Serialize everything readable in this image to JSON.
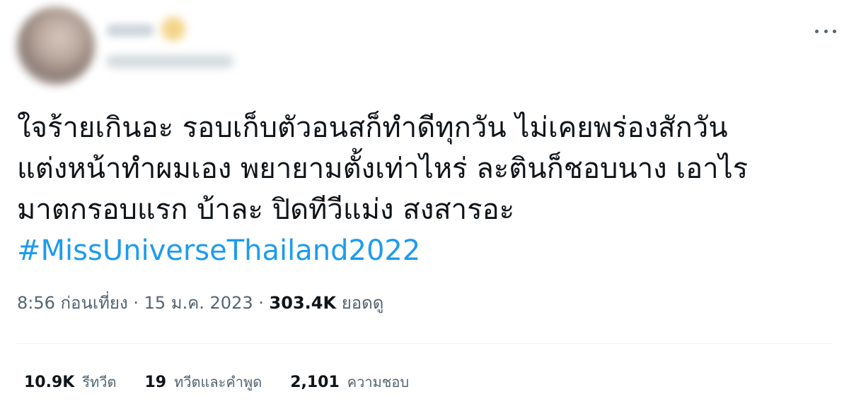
{
  "tweet": {
    "more_icon": "more-horizontal-icon",
    "text_lines": [
      "ใจร้ายเกินอะ รอบเก็บตัวอนสก็ทำดีทุกวัน ไม่เคยพร่องสักวัน",
      "แต่งหน้าทำผมเอง พยายามตั้งเท่าไหร่ ละตินก็ชอบนาง เอาไร",
      "มาตกรอบแรก บ้าละ ปิดทีวีแม่ง สงสารอะ"
    ],
    "hashtag": "#MissUniverseThailand2022",
    "time": "8:56 ก่อนเที่ยง",
    "separator": "·",
    "date": "15 ม.ค. 2023",
    "views_count": "303.4K",
    "views_label": "ยอดดู"
  },
  "stats": {
    "retweets_count": "10.9K",
    "retweets_label": "รีทวีต",
    "quotes_count": "19",
    "quotes_label": "ทวีตและคำพูด",
    "likes_count": "2,101",
    "likes_label": "ความชอบ"
  },
  "colors": {
    "link": "#1d9bf0",
    "text": "#0f1419",
    "secondary": "#536471",
    "divider": "#eff3f4"
  }
}
